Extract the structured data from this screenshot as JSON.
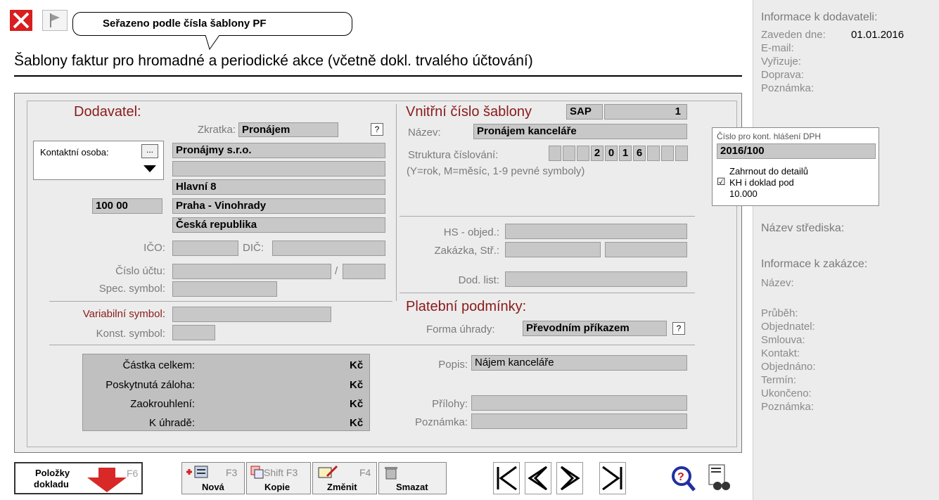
{
  "tooltip": "Seřazeno podle čísla šablony PF",
  "page_title": "Šablony faktur pro hromadné a periodické akce (včetně dokl. trvalého účtování)",
  "supplier": {
    "heading": "Dodavatel:",
    "abbr_label": "Zkratka:",
    "abbr_value": "Pronájem",
    "help": "?",
    "contact_label": "Kontaktní osoba:",
    "contact_btn": "...",
    "name1": "Pronájmy s.r.o.",
    "name2": "",
    "street": "Hlavní 8",
    "zip": "100 00",
    "city": "Praha - Vinohrady",
    "country": "Česká republika",
    "ico_label": "IČO:",
    "dic_label": "DIČ:",
    "account_label": "Číslo účtu:",
    "account_sep": "/",
    "spec_label": "Spec. symbol:",
    "var_label": "Variabilní symbol:",
    "konst_label": "Konst. symbol:"
  },
  "template": {
    "heading": "Vnitřní číslo šablony",
    "prefix": "SAP",
    "number": "1",
    "name_label": "Název:",
    "name_value": "Pronájem kanceláře",
    "struct_label": "Struktura číslování:",
    "struct_cells": [
      "",
      "",
      "",
      "2",
      "0",
      "1",
      "6",
      "",
      "",
      ""
    ],
    "struct_hint": "(Y=rok, M=měsíc, 1-9 pevné symboly)",
    "hs_label": "HS - objed.:",
    "zakazka_label": "Zakázka, Stř.:",
    "dodlist_label": "Dod. list:"
  },
  "payment": {
    "heading": "Platební podmínky:",
    "forma_label": "Forma úhrady:",
    "forma_value": "Převodním příkazem",
    "help": "?",
    "popis_label": "Popis:",
    "popis_value": "Nájem kanceláře",
    "prilohy_label": "Přílohy:",
    "poznamka_label": "Poznámka:"
  },
  "totals": {
    "rows": [
      {
        "label": "Částka celkem:",
        "currency": "Kč"
      },
      {
        "label": "Poskytnutá záloha:",
        "currency": "Kč"
      },
      {
        "label": "Zaokrouhlení:",
        "currency": "Kč"
      },
      {
        "label": "K úhradě:",
        "currency": "Kč"
      }
    ]
  },
  "vat_popup": {
    "title": "Číslo pro kont. hlášení DPH",
    "value": "2016/100",
    "line1": "Zahrnout do detailů",
    "check": "☑",
    "line2": "KH i doklad pod",
    "line3": "10.000"
  },
  "side": {
    "supplier_info": "Informace k dodavateli:",
    "zaveden_label": "Zaveden dne:",
    "zaveden_value": "01.01.2016",
    "email": "E-mail:",
    "vyrizuje": "Vyřizuje:",
    "doprava": "Doprava:",
    "poznamka": "Poznámka:",
    "stredisko": "Název střediska:",
    "order_info": "Informace k zakázce:",
    "nazev": "Název:",
    "prubeh": "Průběh:",
    "objednatel": "Objednatel:",
    "smlouva": "Smlouva:",
    "kontakt": "Kontakt:",
    "objednano": "Objednáno:",
    "termin": "Termín:",
    "ukonceno": "Ukončeno:",
    "poznamka2": "Poznámka:"
  },
  "toolbar": {
    "items_line1": "Položky",
    "items_line2": "dokladu",
    "items_key": "F6",
    "new_key": "F3",
    "new_label": "Nová",
    "copy_key": "Shift F3",
    "copy_label": "Kopie",
    "edit_key": "F4",
    "edit_label": "Změnit",
    "delete_label": "Smazat"
  }
}
